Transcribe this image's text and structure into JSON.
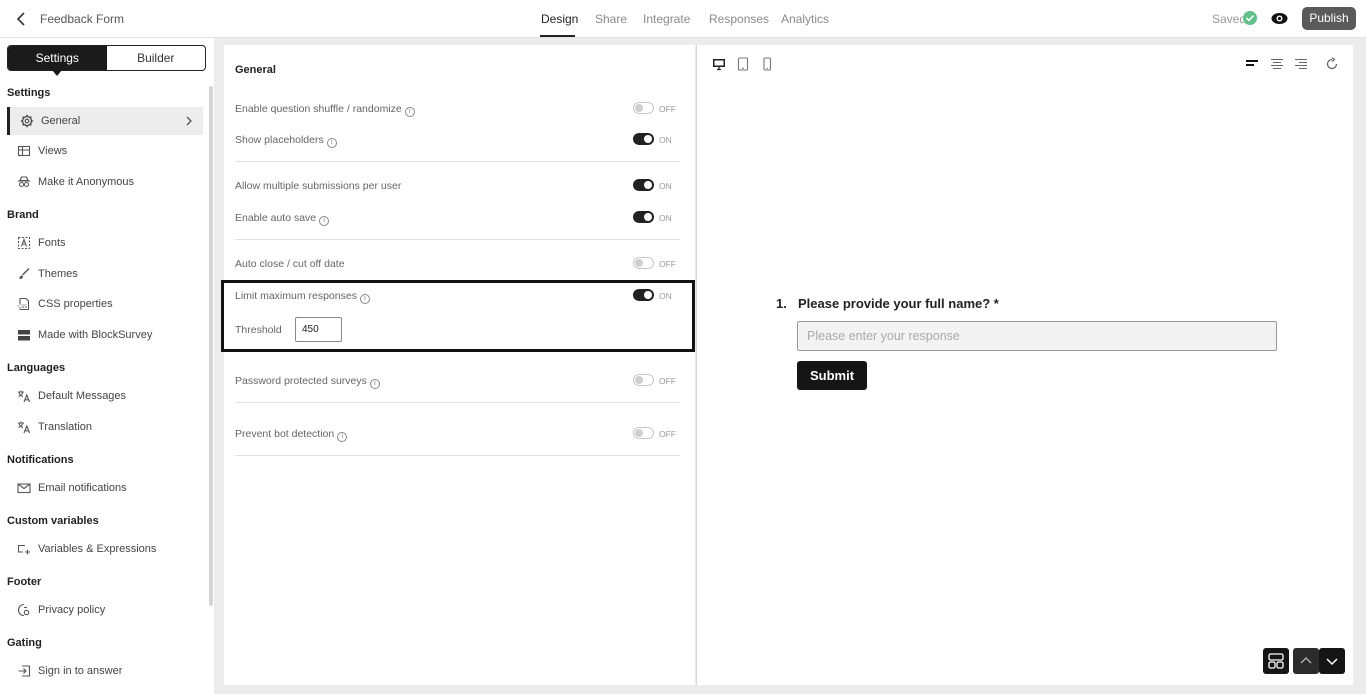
{
  "header": {
    "form_title": "Feedback Form",
    "tabs": [
      {
        "label": "Design",
        "active": true
      },
      {
        "label": "Share",
        "active": false
      },
      {
        "label": "Integrate",
        "active": false
      },
      {
        "label": "Responses",
        "active": false
      },
      {
        "label": "Analytics",
        "active": false
      }
    ],
    "saved_label": "Saved",
    "publish_label": "Publish"
  },
  "sidebar": {
    "segments": [
      "Settings",
      "Builder"
    ],
    "sections": [
      {
        "title": "Settings",
        "items": [
          {
            "label": "General",
            "icon": "gear-icon",
            "selected": true
          },
          {
            "label": "Views",
            "icon": "views-icon"
          },
          {
            "label": "Make it Anonymous",
            "icon": "incognito-icon"
          }
        ]
      },
      {
        "title": "Brand",
        "items": [
          {
            "label": "Fonts",
            "icon": "font-icon"
          },
          {
            "label": "Themes",
            "icon": "brush-icon"
          },
          {
            "label": "CSS properties",
            "icon": "css-icon"
          },
          {
            "label": "Made with BlockSurvey",
            "icon": "badge-icon"
          }
        ]
      },
      {
        "title": "Languages",
        "items": [
          {
            "label": "Default Messages",
            "icon": "translate-icon"
          },
          {
            "label": "Translation",
            "icon": "translate-icon"
          }
        ]
      },
      {
        "title": "Notifications",
        "items": [
          {
            "label": "Email notifications",
            "icon": "mail-icon"
          }
        ]
      },
      {
        "title": "Custom variables",
        "items": [
          {
            "label": "Variables & Expressions",
            "icon": "variable-icon"
          }
        ]
      },
      {
        "title": "Footer",
        "items": [
          {
            "label": "Privacy policy",
            "icon": "privacy-icon"
          }
        ]
      },
      {
        "title": "Gating",
        "items": [
          {
            "label": "Sign in to answer",
            "icon": "signin-icon"
          }
        ]
      }
    ]
  },
  "settings": {
    "heading": "General",
    "rows": [
      {
        "label": "Enable question shuffle / randomize",
        "info": true,
        "on": false,
        "state": "OFF"
      },
      {
        "label": "Show placeholders",
        "info": true,
        "on": true,
        "state": "ON"
      },
      {
        "label": "Allow multiple submissions per user",
        "info": false,
        "on": true,
        "state": "ON"
      },
      {
        "label": "Enable auto save",
        "info": true,
        "on": true,
        "state": "ON"
      },
      {
        "label": "Auto close / cut off date",
        "info": false,
        "on": false,
        "state": "OFF"
      },
      {
        "label": "Limit maximum responses",
        "info": true,
        "on": true,
        "state": "ON"
      },
      {
        "label": "Password protected surveys",
        "info": true,
        "on": false,
        "state": "OFF"
      },
      {
        "label": "Prevent bot detection",
        "info": true,
        "on": false,
        "state": "OFF"
      }
    ],
    "threshold_label": "Threshold",
    "threshold_value": "450",
    "info_glyph": "i"
  },
  "preview": {
    "question_number": "1.",
    "question_text": "Please provide your full name? *",
    "input_placeholder": "Please enter your response",
    "submit_label": "Submit"
  }
}
